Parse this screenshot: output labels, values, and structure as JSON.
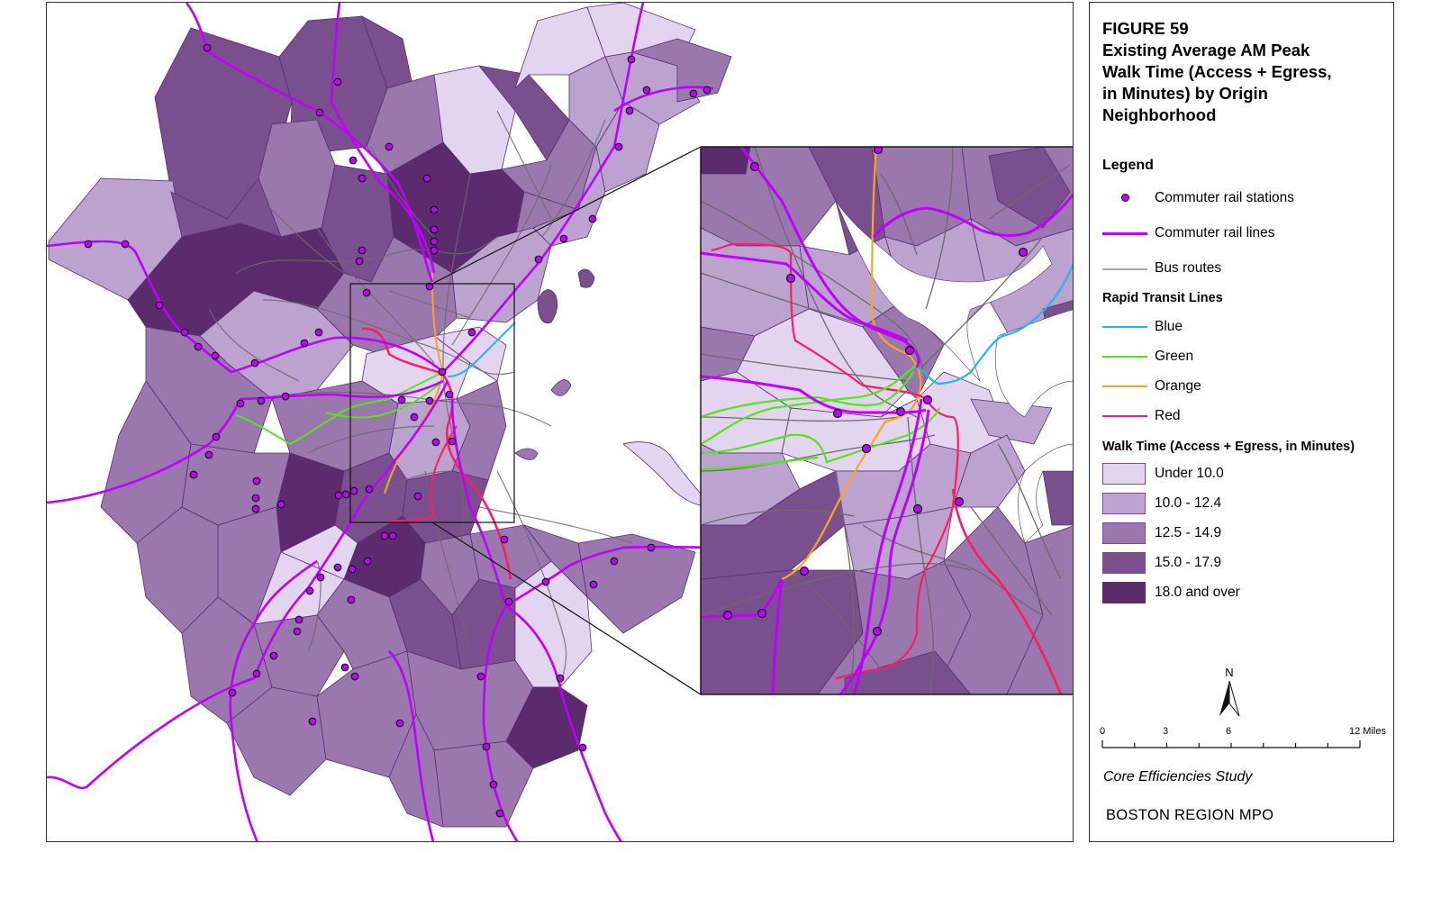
{
  "figure": {
    "number_label": "FIGURE 59",
    "title_lines": [
      "Existing Average AM Peak",
      "Walk Time (Access + Egress,",
      "in Minutes) by Origin",
      "Neighborhood"
    ]
  },
  "legend": {
    "heading": "Legend",
    "items": [
      {
        "label": "Commuter rail stations",
        "symbol": "station-dot",
        "color": "#c000ff"
      },
      {
        "label": "Commuter rail lines",
        "symbol": "line",
        "color": "#c000ff"
      },
      {
        "label": "Bus routes",
        "symbol": "line",
        "color": "#a9a9a9"
      }
    ],
    "rapid_transit_heading": "Rapid Transit Lines",
    "rapid_transit": [
      {
        "label": "Blue",
        "color": "#1fb8f0"
      },
      {
        "label": "Green",
        "color": "#55e61a"
      },
      {
        "label": "Orange",
        "color": "#ffa31a"
      },
      {
        "label": "Red",
        "color": "#ff1a66"
      }
    ],
    "walk_time_heading": "Walk Time (Access + Egress, in Minutes)",
    "walk_time_classes": [
      {
        "label": "Under 10.0",
        "color": "#e3d4ef"
      },
      {
        "label": "10.0 - 12.4",
        "color": "#bba2cf"
      },
      {
        "label": "12.5 - 14.9",
        "color": "#9a77ad"
      },
      {
        "label": "15.0 - 17.9",
        "color": "#7a4f8d"
      },
      {
        "label": "18.0 and over",
        "color": "#5b2b6e"
      }
    ]
  },
  "north_arrow": {
    "label": "N"
  },
  "scale_bar": {
    "ticks": [
      "0",
      "3",
      "6",
      "12 Miles"
    ]
  },
  "credits": {
    "study": "Core Efficiencies Study",
    "agency": "BOSTON REGION MPO"
  },
  "colors": {
    "commuter_rail": "#c000ff",
    "bus": "#6b6b6b",
    "station_fill": "#c000ff",
    "boundary": "#5a2d78"
  }
}
